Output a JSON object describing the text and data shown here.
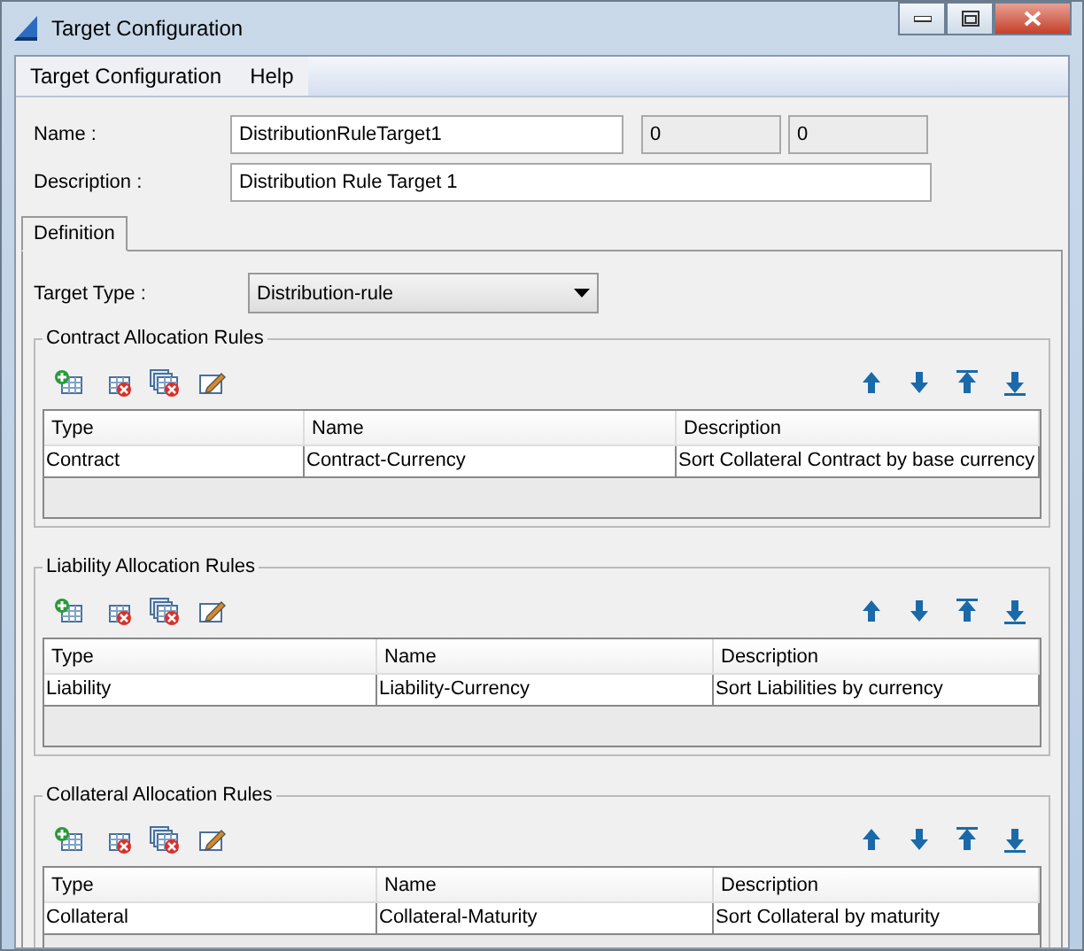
{
  "window": {
    "title": "Target Configuration"
  },
  "menu": [
    "Target Configuration",
    "Help"
  ],
  "name": {
    "label": "Name :",
    "value": "DistributionRuleTarget1",
    "counters": [
      "0",
      "0"
    ]
  },
  "description": {
    "label": "Description :",
    "value": "Distribution Rule Target 1"
  },
  "tabs": [
    {
      "label": "Definition",
      "selected": true
    }
  ],
  "target_type": {
    "label": "Target Type :",
    "value": "Distribution-rule"
  },
  "sections": [
    {
      "title": "Contract Allocation Rules",
      "columns": [
        "Type",
        "Name",
        "Description"
      ],
      "rows": [
        [
          "Contract",
          "Contract-Currency",
          "Sort Collateral Contract by base currency"
        ]
      ]
    },
    {
      "title": "Liability Allocation Rules",
      "columns": [
        "Type",
        "Name",
        "Description"
      ],
      "rows": [
        [
          "Liability",
          "Liability-Currency",
          "Sort Liabilities by currency"
        ]
      ]
    },
    {
      "title": "Collateral Allocation Rules",
      "columns": [
        "Type",
        "Name",
        "Description"
      ],
      "rows": [
        [
          "Collateral",
          "Collateral-Maturity",
          "Sort Collateral by maturity"
        ]
      ]
    }
  ]
}
